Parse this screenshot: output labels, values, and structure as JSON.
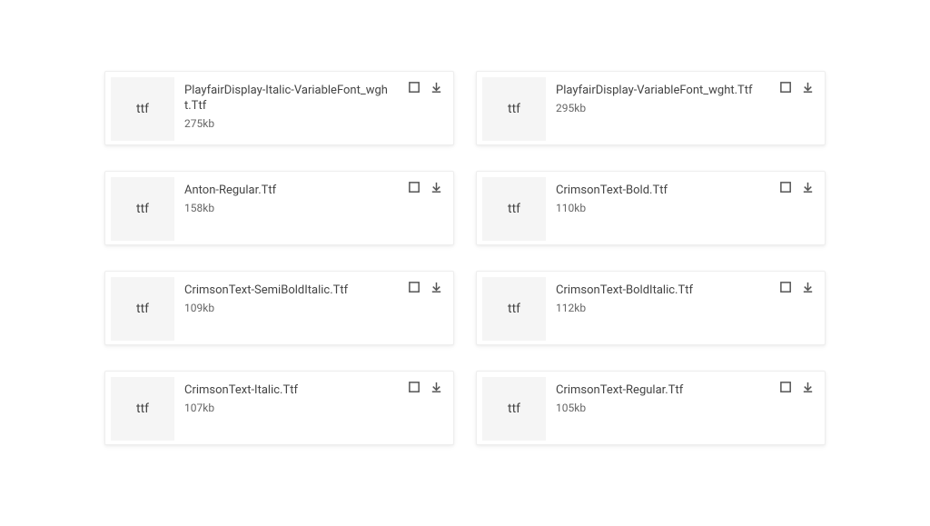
{
  "ext_label": "ttf",
  "files": [
    {
      "name": "PlayfairDisplay-Italic-VariableFont_wght.Ttf",
      "size": "275kb"
    },
    {
      "name": "PlayfairDisplay-VariableFont_wght.Ttf",
      "size": "295kb"
    },
    {
      "name": "Anton-Regular.Ttf",
      "size": "158kb"
    },
    {
      "name": "CrimsonText-Bold.Ttf",
      "size": "110kb"
    },
    {
      "name": "CrimsonText-SemiBoldItalic.Ttf",
      "size": "109kb"
    },
    {
      "name": "CrimsonText-BoldItalic.Ttf",
      "size": "112kb"
    },
    {
      "name": "CrimsonText-Italic.Ttf",
      "size": "107kb"
    },
    {
      "name": "CrimsonText-Regular.Ttf",
      "size": "105kb"
    }
  ]
}
